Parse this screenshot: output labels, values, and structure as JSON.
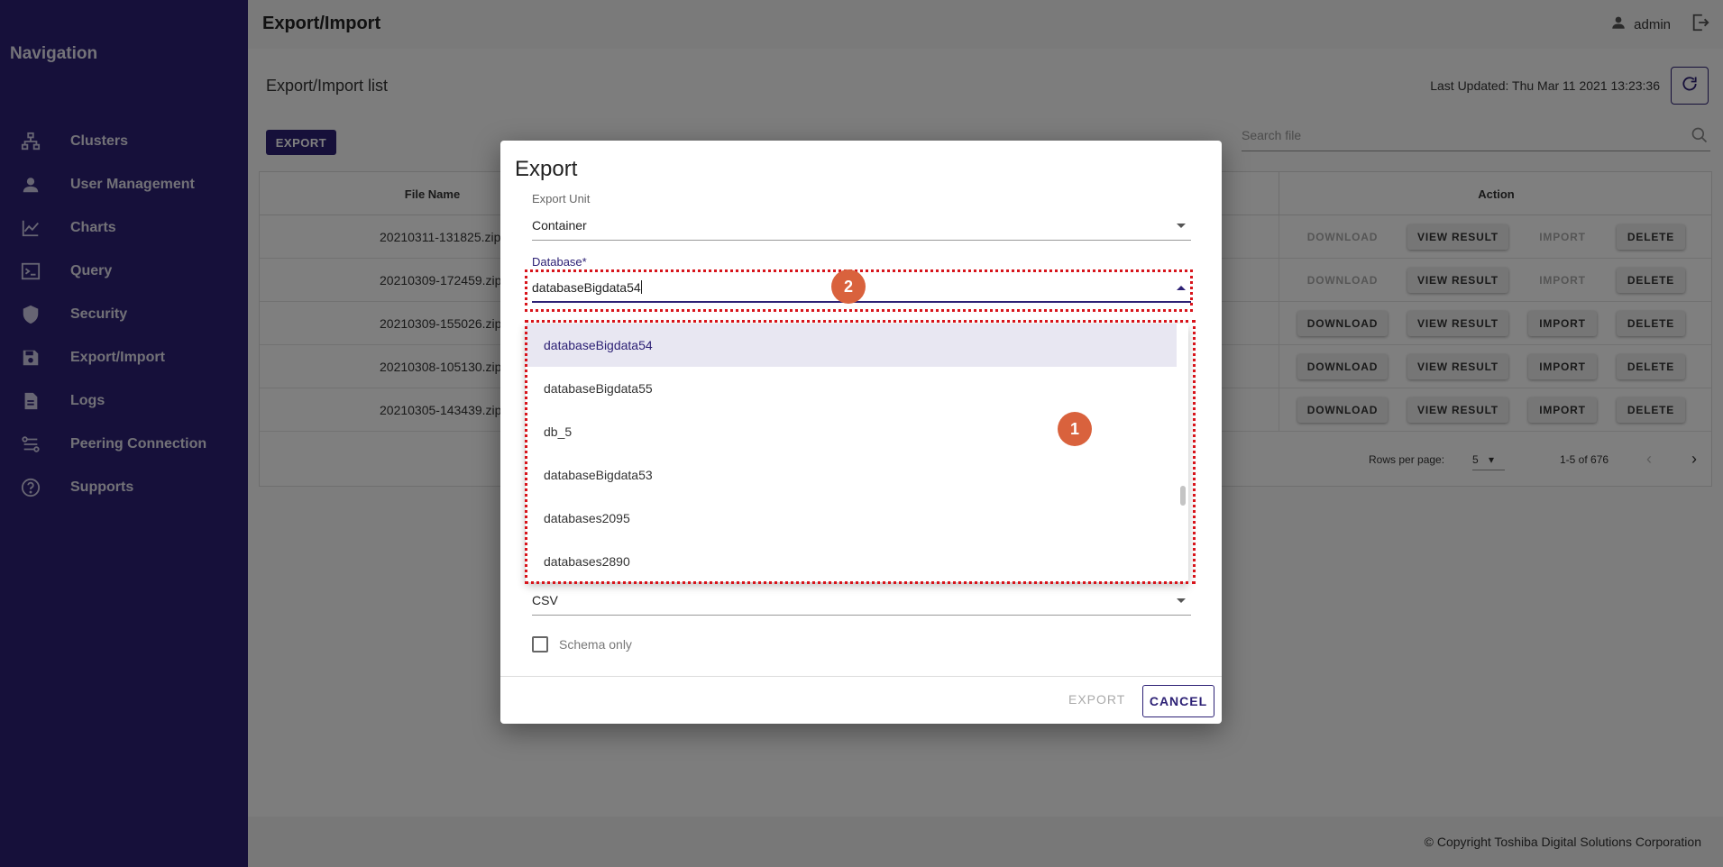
{
  "sidebar": {
    "title": "Navigation",
    "items": [
      {
        "label": "Clusters",
        "icon": "clusters-icon"
      },
      {
        "label": "User Management",
        "icon": "user-icon"
      },
      {
        "label": "Charts",
        "icon": "chart-icon"
      },
      {
        "label": "Query",
        "icon": "terminal-icon"
      },
      {
        "label": "Security",
        "icon": "shield-icon"
      },
      {
        "label": "Export/Import",
        "icon": "save-icon"
      },
      {
        "label": "Logs",
        "icon": "document-icon"
      },
      {
        "label": "Peering Connection",
        "icon": "peering-icon"
      },
      {
        "label": "Supports",
        "icon": "help-icon"
      }
    ]
  },
  "header": {
    "title": "Export/Import",
    "user": "admin"
  },
  "main": {
    "list_title": "Export/Import list",
    "last_updated": "Last Updated: Thu Mar 11 2021 13:23:36",
    "export_button": "EXPORT",
    "search_placeholder": "Search file",
    "columns": {
      "file_name": "File Name",
      "action": "Action"
    },
    "rows": [
      {
        "file": "20210311-131825.zip",
        "download": "DOWNLOAD",
        "view": "VIEW RESULT",
        "import": "IMPORT",
        "delete": "DELETE",
        "enabled": false
      },
      {
        "file": "20210309-172459.zip",
        "download": "DOWNLOAD",
        "view": "VIEW RESULT",
        "import": "IMPORT",
        "delete": "DELETE",
        "enabled": false
      },
      {
        "file": "20210309-155026.zip",
        "download": "DOWNLOAD",
        "view": "VIEW RESULT",
        "import": "IMPORT",
        "delete": "DELETE",
        "enabled": true
      },
      {
        "file": "20210308-105130.zip",
        "download": "DOWNLOAD",
        "view": "VIEW RESULT",
        "import": "IMPORT",
        "delete": "DELETE",
        "enabled": true
      },
      {
        "file": "20210305-143439.zip",
        "download": "DOWNLOAD",
        "view": "VIEW RESULT",
        "import": "IMPORT",
        "delete": "DELETE",
        "enabled": true
      }
    ],
    "pagination": {
      "rows_per_page_label": "Rows per page:",
      "rows_per_page": "5",
      "range": "1-5 of 676"
    }
  },
  "dialog": {
    "title": "Export",
    "export_unit_label": "Export Unit",
    "export_unit_value": "Container",
    "database_label": "Database*",
    "database_value": "databaseBigdata54",
    "options": [
      "databaseBigdata54",
      "databaseBigdata55",
      "db_5",
      "databaseBigdata53",
      "databases2095",
      "databases2890"
    ],
    "format_value": "CSV",
    "schema_only_label": "Schema only",
    "export_button": "EXPORT",
    "cancel_button": "CANCEL"
  },
  "annotations": {
    "badge_1": "1",
    "badge_2": "2"
  },
  "footer": {
    "copyright": "© Copyright Toshiba Digital Solutions Corporation"
  },
  "colors": {
    "primary": "#2d2175",
    "annotation_red": "#d8141b",
    "badge": "#d9623d"
  }
}
